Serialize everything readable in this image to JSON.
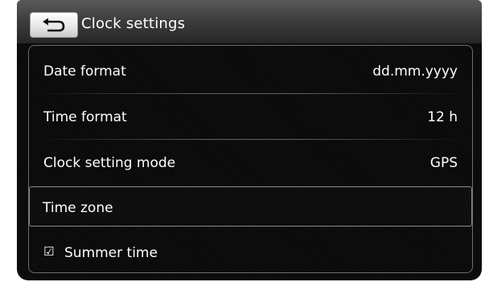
{
  "header": {
    "title": "Clock settings",
    "back_icon": "back-arrow-icon"
  },
  "rows": [
    {
      "label": "Date format",
      "value": "dd.mm.yyyy"
    },
    {
      "label": "Time format",
      "value": "12 h"
    },
    {
      "label": "Clock setting mode",
      "value": "GPS"
    },
    {
      "label": "Time zone",
      "selected": true
    },
    {
      "label": "Summer time",
      "checkbox_glyph": "☑",
      "checked": true
    }
  ],
  "colors": {
    "background": "#0a0a0a",
    "text": "#ffffff",
    "header_top": "#5a5a5a",
    "border": "#6e6e6e"
  }
}
